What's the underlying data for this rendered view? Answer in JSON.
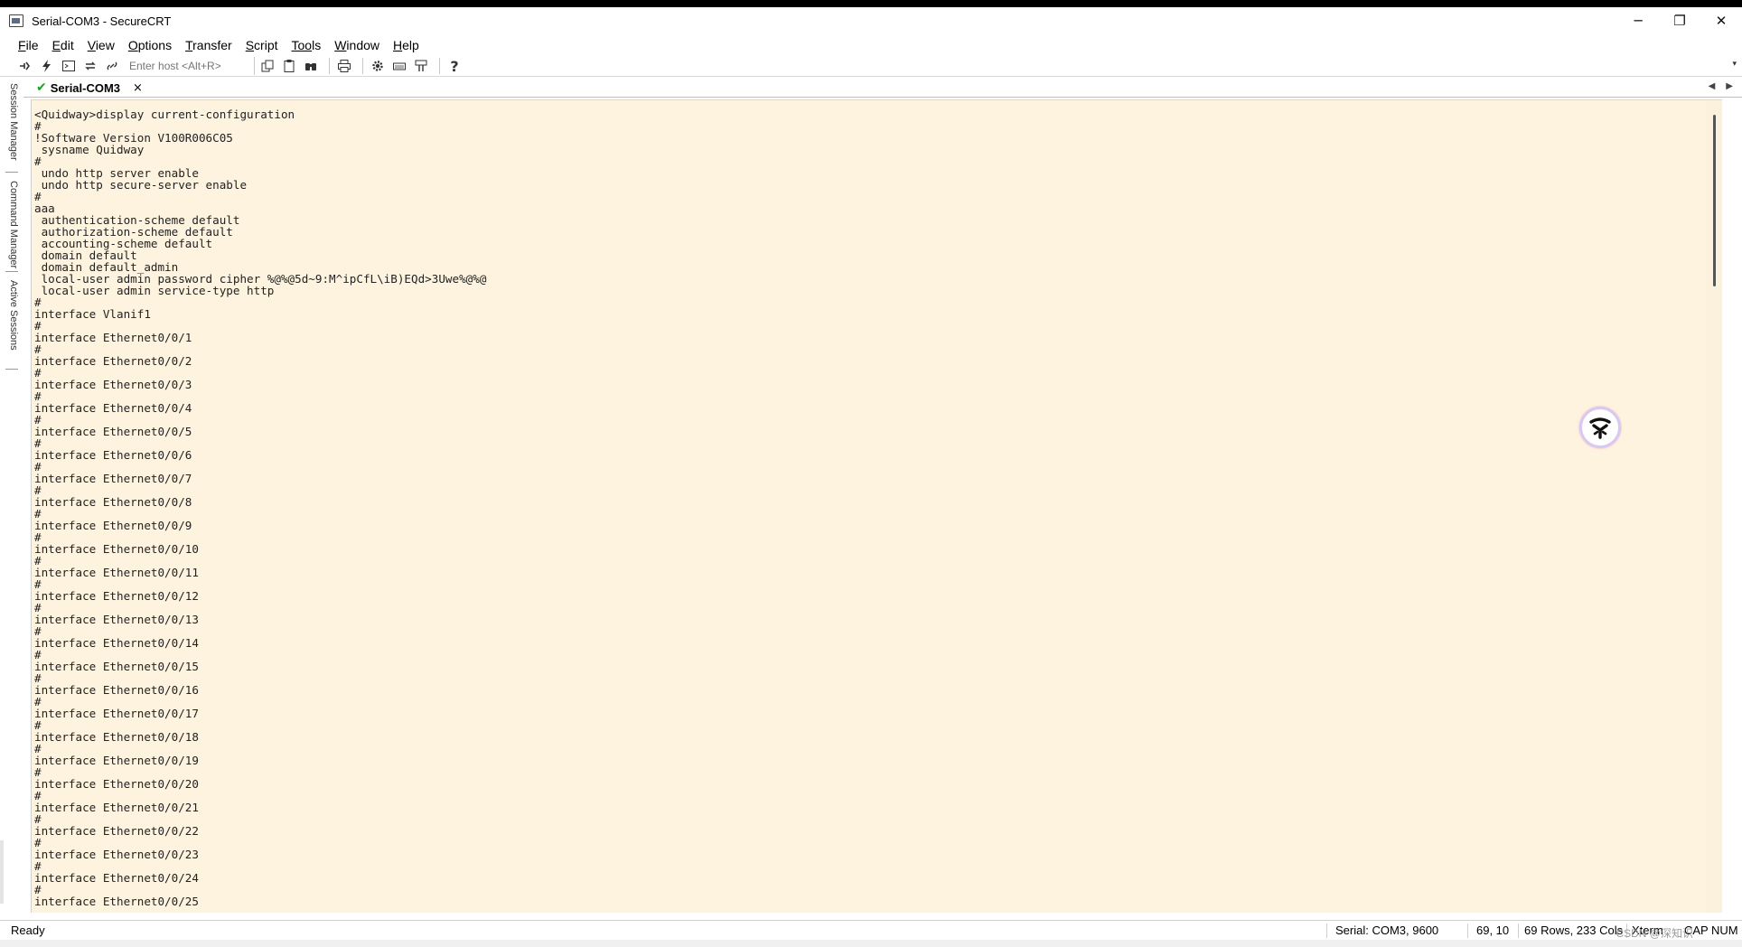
{
  "window": {
    "title": "Serial-COM3 - SecureCRT",
    "minimize": "─",
    "restore": "❐",
    "close": "✕"
  },
  "menu": [
    {
      "ul": "F",
      "rest": "ile"
    },
    {
      "ul": "E",
      "rest": "dit"
    },
    {
      "ul": "V",
      "rest": "iew"
    },
    {
      "ul": "O",
      "rest": "ptions"
    },
    {
      "ul": "T",
      "rest": "ransfer"
    },
    {
      "ul": "S",
      "rest": "cript"
    },
    {
      "ul": "Too",
      "rest": "ls"
    },
    {
      "ul": "W",
      "rest": "indow"
    },
    {
      "ul": "H",
      "rest": "elp"
    }
  ],
  "toolbar": {
    "host_placeholder": "Enter host <Alt+R>"
  },
  "side_panels": {
    "session_manager": "Session Manager",
    "command_manager": "Command Manager",
    "active_sessions": "Active Sessions"
  },
  "tab": {
    "label": "Serial-COM3",
    "close": "×"
  },
  "terminal": {
    "lines": [
      "<Quidway>display current-configuration",
      "#",
      "!Software Version V100R006C05",
      " sysname Quidway",
      "#",
      " undo http server enable",
      " undo http secure-server enable",
      "#",
      "aaa",
      " authentication-scheme default",
      " authorization-scheme default",
      " accounting-scheme default",
      " domain default",
      " domain default_admin",
      " local-user admin password cipher %@%@5d~9:M^ipCfL\\iB)EQd>3Uwe%@%@",
      " local-user admin service-type http",
      "#",
      "interface Vlanif1",
      "#",
      "interface Ethernet0/0/1",
      "#",
      "interface Ethernet0/0/2",
      "#",
      "interface Ethernet0/0/3",
      "#",
      "interface Ethernet0/0/4",
      "#",
      "interface Ethernet0/0/5",
      "#",
      "interface Ethernet0/0/6",
      "#",
      "interface Ethernet0/0/7",
      "#",
      "interface Ethernet0/0/8",
      "#",
      "interface Ethernet0/0/9",
      "#",
      "interface Ethernet0/0/10",
      "#",
      "interface Ethernet0/0/11",
      "#",
      "interface Ethernet0/0/12",
      "#",
      "interface Ethernet0/0/13",
      "#",
      "interface Ethernet0/0/14",
      "#",
      "interface Ethernet0/0/15",
      "#",
      "interface Ethernet0/0/16",
      "#",
      "interface Ethernet0/0/17",
      "#",
      "interface Ethernet0/0/18",
      "#",
      "interface Ethernet0/0/19",
      "#",
      "interface Ethernet0/0/20",
      "#",
      "interface Ethernet0/0/21",
      "#",
      "interface Ethernet0/0/22",
      "#",
      "interface Ethernet0/0/23",
      "#",
      "interface Ethernet0/0/24",
      "#",
      "interface Ethernet0/0/25"
    ],
    "bg_color": "#fdf3df"
  },
  "status": {
    "ready": "Ready",
    "connection": "Serial: COM3, 9600",
    "cursor": "69,  10",
    "size": "69 Rows, 233 Cols",
    "emulation": "Xterm",
    "caps": "CAP",
    "num": "NUM",
    "watermark": "CSDN @深知识"
  }
}
